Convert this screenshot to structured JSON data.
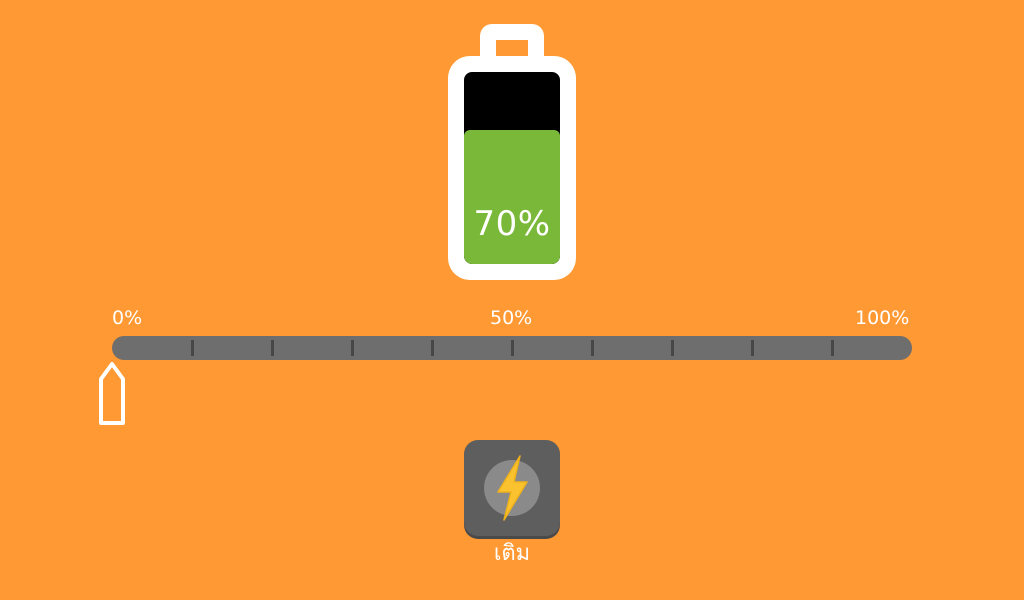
{
  "battery": {
    "level": 0.7,
    "percent_label": "70%",
    "fill_color": "#7AB83A",
    "empty_color": "#000000",
    "frame_color": "#FFFFFF"
  },
  "slider": {
    "labels": {
      "min": "0%",
      "mid": "50%",
      "max": "100%"
    },
    "value": 0,
    "tick_count": 9,
    "track_color": "#6E6E6E",
    "tick_color": "#474747"
  },
  "charge_button": {
    "label": "เติม",
    "icon": "lightning-bolt-icon",
    "icon_color": "#F9C22E"
  },
  "background_color": "#FF9933"
}
